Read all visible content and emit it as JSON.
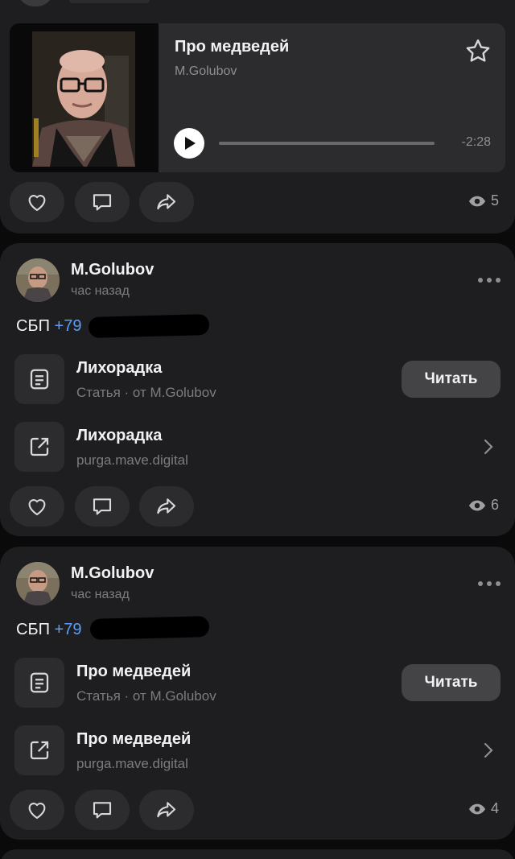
{
  "audio_post": {
    "track_title": "Про медведей",
    "artist": "M.Golubov",
    "remaining": "-2:28",
    "progress": 0.0,
    "views": "5"
  },
  "posts": [
    {
      "author": "M.Golubov",
      "time": "час назад",
      "sbp_label": "СБП",
      "phone_visible": "+79",
      "article_title": "Лихорадка",
      "article_sub": "Статья · от M.Golubov",
      "read_label": "Читать",
      "link_title": "Лихорадка",
      "link_domain": "purga.mave.digital",
      "views": "6"
    },
    {
      "author": "M.Golubov",
      "time": "час назад",
      "sbp_label": "СБП",
      "phone_visible": "+79",
      "article_title": "Про медведей",
      "article_sub": "Статья · от M.Golubov",
      "read_label": "Читать",
      "link_title": "Про медведей",
      "link_domain": "purga.mave.digital",
      "views": "4"
    }
  ],
  "colors": {
    "background": "#0a0a0a",
    "card": "#1e1e20",
    "accent_link": "#5a9ef5",
    "button": "#444446"
  },
  "icons": [
    "star-icon",
    "play-icon",
    "heart-icon",
    "comment-icon",
    "share-icon",
    "eye-icon",
    "more-icon",
    "article-icon",
    "external-link-icon",
    "chevron-right-icon"
  ]
}
